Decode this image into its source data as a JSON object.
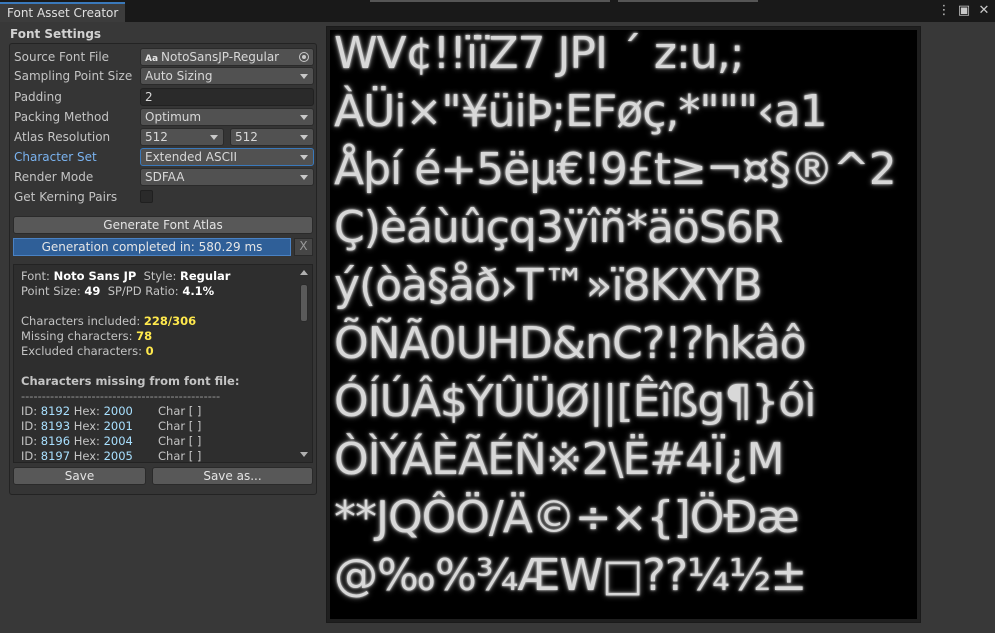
{
  "window": {
    "tab_title": "Font Asset Creator",
    "icons": [
      "more-vert-icon",
      "maximize-icon",
      "close-icon"
    ]
  },
  "settings": {
    "section_title": "Font Settings",
    "source_font_file": {
      "label": "Source Font File",
      "value": "NotoSansJP-Regular",
      "icon": "font-asset-icon"
    },
    "sampling_point_size": {
      "label": "Sampling Point Size",
      "value": "Auto Sizing"
    },
    "padding": {
      "label": "Padding",
      "value": "2"
    },
    "packing_method": {
      "label": "Packing Method",
      "value": "Optimum"
    },
    "atlas_resolution": {
      "label": "Atlas Resolution",
      "width": "512",
      "height": "512"
    },
    "character_set": {
      "label": "Character Set",
      "value": "Extended ASCII"
    },
    "render_mode": {
      "label": "Render Mode",
      "value": "SDFAA"
    },
    "get_kerning_pairs": {
      "label": "Get Kerning Pairs",
      "checked": false
    }
  },
  "actions": {
    "generate_label": "Generate Font Atlas",
    "progress_text": "Generation completed in: 580.29 ms",
    "progress_value": 1.0,
    "clear_label": "X",
    "save_label": "Save",
    "save_as_label": "Save as..."
  },
  "info": {
    "font_label": "Font:",
    "font_value": "Noto Sans JP",
    "style_label": "Style:",
    "style_value": "Regular",
    "point_size_label": "Point Size:",
    "point_size_value": "49",
    "ratio_label": "SP/PD Ratio:",
    "ratio_value": "4.1%",
    "included_label": "Characters included:",
    "included_value": "228/306",
    "missing_label": "Missing characters:",
    "missing_value": "78",
    "excluded_label": "Excluded characters:",
    "excluded_value": "0",
    "missing_title": "Characters missing from font file:",
    "separator": "------------------------------------------------",
    "missing_rows": [
      {
        "id": "8192",
        "hex": "2000",
        "char": "Char [  ]"
      },
      {
        "id": "8193",
        "hex": "2001",
        "char": "Char [    ]"
      },
      {
        "id": "8196",
        "hex": "2004",
        "char": "Char [ ]"
      },
      {
        "id": "8197",
        "hex": "2005",
        "char": "Char [ ]"
      }
    ],
    "id_label": "ID:",
    "hex_label": "Hex:"
  },
  "atlas_rows": [
    "WV¢!!ïïZ7 JPI ´ z:u,;",
    "ÀÜi×\"¥üiÞ;EFøç,*\"\"\"‹a1",
    "Åþí é+5ëµ€!9£t≥¬¤§®^2",
    "Ç)èáùûçq3ÿîñ*äöS6R",
    "ý(òà§åð›T™»ï8KXYB",
    "ÕÑÃ0UHD&nC?!?hkâô",
    "ÓÍÚÂ$ÝÛÜØ||[Êîßg¶}óì",
    "ÒÌÝÁÈÃÉÑ※2\\Ë#4Ï¿M",
    "**JQÔÖ/Ä©÷×{]ÖÐæ",
    "@‰%¾ÆW□??¼½±"
  ]
}
